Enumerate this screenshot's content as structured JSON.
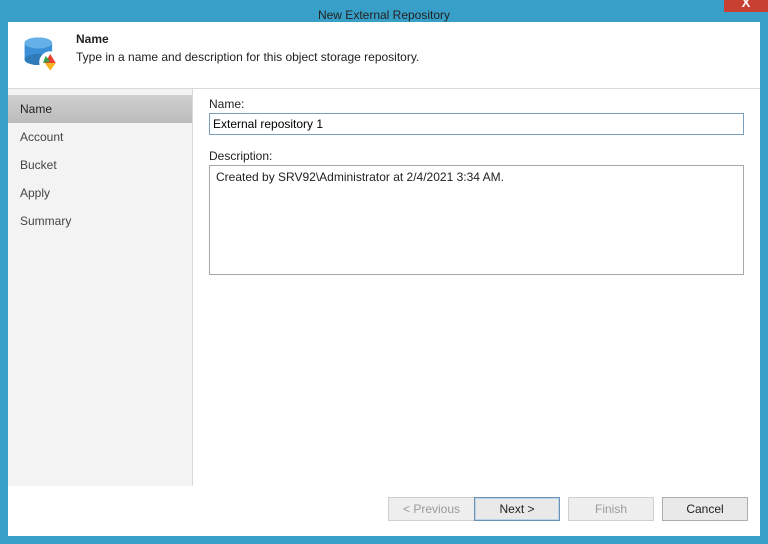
{
  "window": {
    "title": "New External Repository",
    "close_glyph": "X"
  },
  "header": {
    "title": "Name",
    "subtitle": "Type in a name and description for this object storage repository."
  },
  "sidebar": {
    "items": [
      {
        "label": "Name",
        "active": true
      },
      {
        "label": "Account",
        "active": false
      },
      {
        "label": "Bucket",
        "active": false
      },
      {
        "label": "Apply",
        "active": false
      },
      {
        "label": "Summary",
        "active": false
      }
    ]
  },
  "form": {
    "name_label": "Name:",
    "name_value": "External repository 1",
    "description_label": "Description:",
    "description_value": "Created by SRV92\\Administrator at 2/4/2021 3:34 AM."
  },
  "footer": {
    "previous": "< Previous",
    "next": "Next >",
    "finish": "Finish",
    "cancel": "Cancel"
  },
  "colors": {
    "frame": "#38a0c8",
    "close": "#c84031",
    "selection": "#0078d7"
  }
}
